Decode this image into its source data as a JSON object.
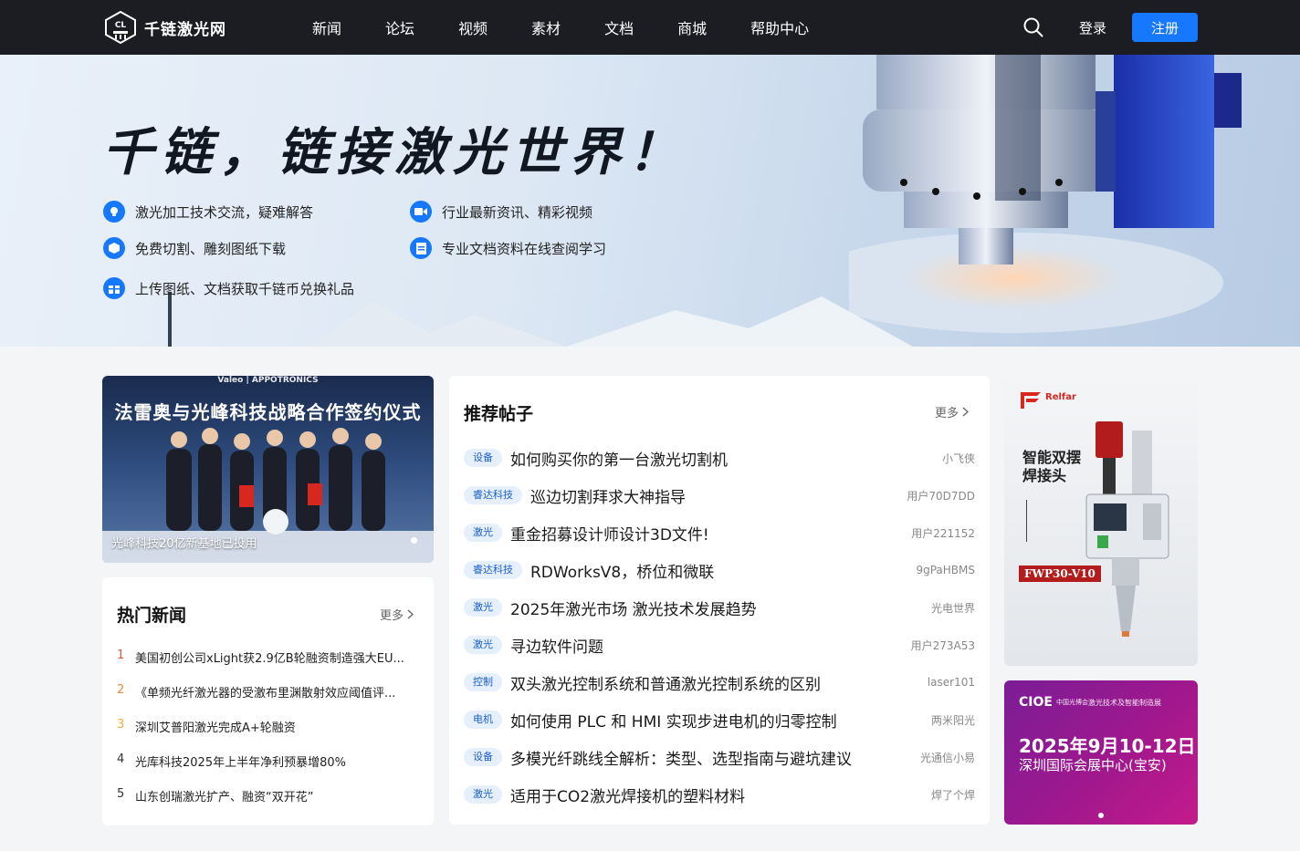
{
  "brand": {
    "name": "千链激光网",
    "mark": "CL"
  },
  "nav": {
    "items": [
      "新闻",
      "论坛",
      "视频",
      "素材",
      "文档",
      "商城",
      "帮助中心"
    ],
    "login": "登录",
    "register": "注册"
  },
  "hero": {
    "title": "千链，链接激光世界！",
    "features": [
      "激光加工技术交流，疑难解答",
      "行业最新资讯、精彩视频",
      "免费切割、雕刻图纸下载",
      "专业文档资料在线查阅学习",
      "上传图纸、文档获取千链币兑换礼品"
    ]
  },
  "banner": {
    "brands": "Valeo | APPOTRONICS",
    "headline": "法雷奥与光峰科技战略合作签约仪式",
    "caption": "光峰科技20亿新基地已投用"
  },
  "hot_news": {
    "title": "热门新闻",
    "more": "更多",
    "items": [
      {
        "rank": "1",
        "text": "美国初创公司xLight获2.9亿B轮融资制造强大EU..."
      },
      {
        "rank": "2",
        "text": "《单频光纤激光器的受激布里渊散射效应阈值评..."
      },
      {
        "rank": "3",
        "text": "深圳艾普阳激光完成A+轮融资"
      },
      {
        "rank": "4",
        "text": "光库科技2025年上半年净利预暴增80%"
      },
      {
        "rank": "5",
        "text": "山东创瑞激光扩产、融资“双开花”"
      }
    ],
    "rank_colors": [
      "#e8563a",
      "#ee8a3c",
      "#f1b23d",
      "#333333",
      "#333333"
    ]
  },
  "posts": {
    "title": "推荐帖子",
    "more": "更多",
    "items": [
      {
        "tag": "设备",
        "title": "如何购买你的第一台激光切割机",
        "author": "小飞侠"
      },
      {
        "tag": "睿达科技",
        "title": "巡边切割拜求大神指导",
        "author": "用户70D7DD"
      },
      {
        "tag": "激光",
        "title": "重金招募设计师设计3D文件!",
        "author": "用户221152"
      },
      {
        "tag": "睿达科技",
        "title": "RDWorksV8，桥位和微联",
        "author": "9gPaHBMS"
      },
      {
        "tag": "激光",
        "title": "2025年激光市场 激光技术发展趋势",
        "author": "光电世界"
      },
      {
        "tag": "激光",
        "title": "寻边软件问题",
        "author": "用户273A53"
      },
      {
        "tag": "控制",
        "title": "双头激光控制系统和普通激光控制系统的区别",
        "author": "laser101"
      },
      {
        "tag": "电机",
        "title": "如何使用 PLC 和 HMI 实现步进电机的归零控制",
        "author": "两米阳光"
      },
      {
        "tag": "设备",
        "title": "多模光纤跳线全解析：类型、选型指南与避坑建议",
        "author": "光通信小易"
      },
      {
        "tag": "激光",
        "title": "适用于CO2激光焊接机的塑料材料",
        "author": "焊了个焊"
      }
    ]
  },
  "ad_relfar": {
    "brand": "Relfar",
    "headline_line1": "智能双摆",
    "headline_line2": "焊接头",
    "model": "FWP30-V10"
  },
  "ad_cioe": {
    "brand": "CIOE",
    "brand_sub": "中国光博会",
    "expo": "激光技术及智能制造展",
    "date": "2025年9月10-12日",
    "venue": "深圳国际会展中心(宝安)"
  },
  "colors": {
    "accent": "#1677ff",
    "topbar": "#1b1d22",
    "tag_bg": "#e6f0fd",
    "tag_text": "#1a5fd0"
  }
}
